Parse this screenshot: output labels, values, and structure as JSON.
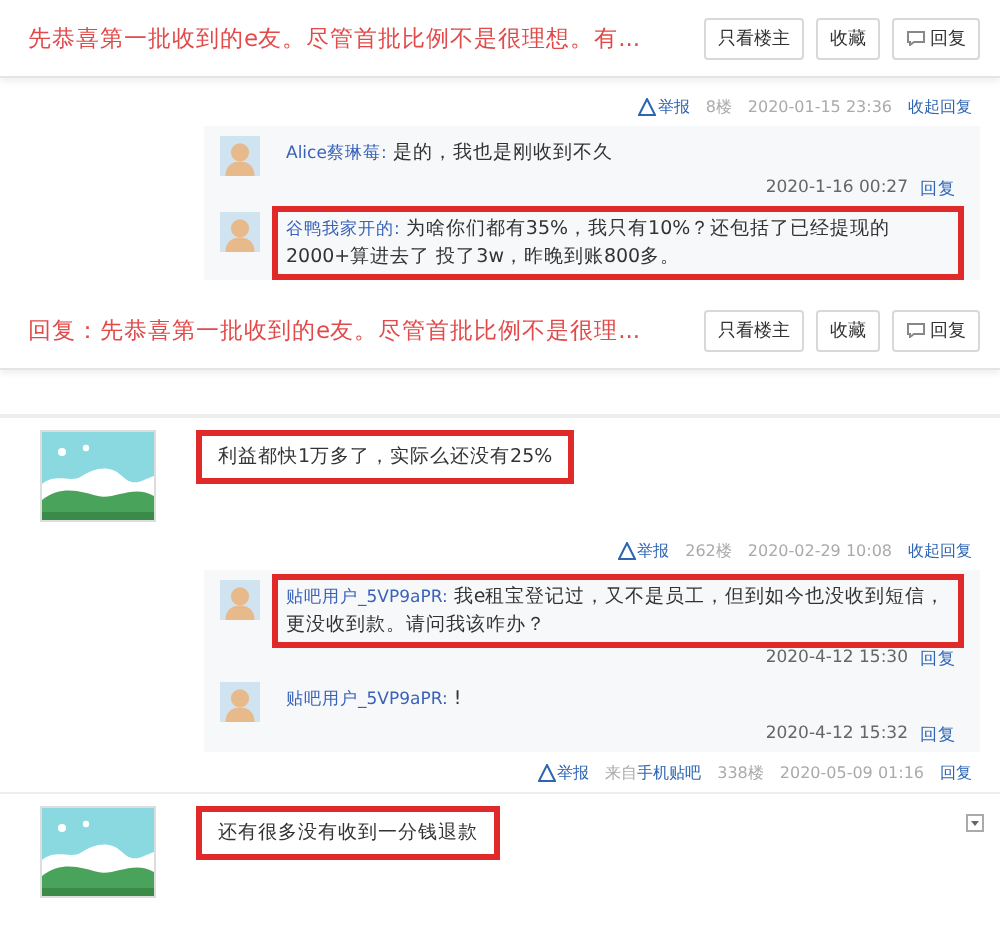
{
  "blocks": [
    {
      "kind": "title_bar",
      "title": "先恭喜第一批收到的e友。尽管首批比例不是很理想。有...",
      "buttons": [
        {
          "label": "只看楼主",
          "kind": "plain"
        },
        {
          "label": "收藏",
          "kind": "plain"
        },
        {
          "label": "回复",
          "kind": "reply"
        }
      ]
    },
    {
      "kind": "floor_footer",
      "report": "举报",
      "floor": "8楼",
      "time": "2020-01-15 23:36",
      "action": "收起回复"
    },
    {
      "kind": "reply_list",
      "replies": [
        {
          "user": "Alice蔡琳莓:",
          "text": "是的，我也是刚收到不久",
          "time": "2020-1-16 00:27",
          "action": "回复",
          "highlighted": false
        },
        {
          "user": "谷鸭我家开的:",
          "text": "为啥你们都有35%，我只有10%？还包括了已经提现的2000+算进去了 投了3w，昨晚到账800多。",
          "highlighted": true
        }
      ]
    },
    {
      "kind": "title_bar",
      "title": "回复：先恭喜第一批收到的e友。尽管首批比例不是很理...",
      "buttons": [
        {
          "label": "只看楼主",
          "kind": "plain"
        },
        {
          "label": "收藏",
          "kind": "plain"
        },
        {
          "label": "回复",
          "kind": "reply"
        }
      ]
    },
    {
      "kind": "post",
      "content": "利益都快1万多了，实际么还没有25%",
      "highlighted": true
    },
    {
      "kind": "floor_footer",
      "report": "举报",
      "floor": "262楼",
      "time": "2020-02-29 10:08",
      "action": "收起回复"
    },
    {
      "kind": "reply_list",
      "replies": [
        {
          "user": "贴吧用户_5VP9aPR:",
          "text": "我e租宝登记过，又不是员工，但到如今也没收到短信，更没收到款。请问我该咋办？",
          "time": "2020-4-12 15:30",
          "action": "回复",
          "highlighted": true
        },
        {
          "user": "贴吧用户_5VP9aPR:",
          "text": "!",
          "time": "2020-4-12 15:32",
          "action": "回复",
          "highlighted": false
        }
      ]
    },
    {
      "kind": "floor_footer",
      "report": "举报",
      "source_prefix": "来自",
      "source_link": "手机贴吧",
      "floor": "338楼",
      "time": "2020-05-09 01:16",
      "action": "回复"
    },
    {
      "kind": "post",
      "content": "还有很多没有收到一分钱退款",
      "highlighted": true,
      "menu": true
    }
  ]
}
